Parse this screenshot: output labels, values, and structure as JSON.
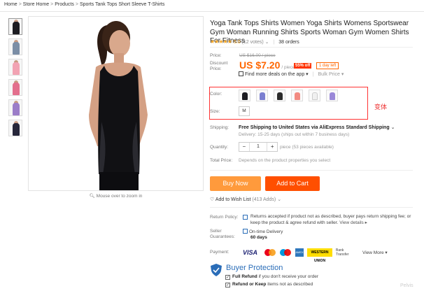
{
  "breadcrumb": [
    "Home",
    "Store Home",
    "Products",
    "Sports Tank Tops Short Sleeve T-Shirts"
  ],
  "gallery": {
    "thumb_colors": [
      "#1c1c22",
      "#7b8ea6",
      "#f2a3b3",
      "#e36f8d",
      "#9b7dc8",
      "#26263a"
    ],
    "zoom_hint": "Mouse over to zoom in"
  },
  "product": {
    "title": "Yoga Tank Tops Shirts Women Yoga Shirts Womens Sportswear Gym Woman Running Shirts Sports Woman Gym Women Shirts For Fitness",
    "rating": "5.0",
    "votes": "(12 votes)",
    "orders": "38 orders",
    "price_label": "Price:",
    "old_price": "US $16.00 / piece",
    "discount_label_1": "Discount",
    "discount_label_2": "Price:",
    "new_price": "US $7.20",
    "unit": "/ piece",
    "discount_badge": "55% off",
    "days_left": "1 day left",
    "app_deals": "Find more deals on the app",
    "bulk_price": "Bulk Price"
  },
  "variants": {
    "color_label": "Color:",
    "color_swatches": [
      "#1c1c22",
      "#7b7fd0",
      "#2b2b2b",
      "#f28b82",
      "#f0f0f0",
      "#9a88d8"
    ],
    "size_label": "Size:",
    "size_value": "M",
    "annotation": "变体"
  },
  "shipping": {
    "label": "Shipping:",
    "text": "Free Shipping to United States via AliExpress Standard Shipping",
    "delivery": "Delivery: 15-25 days (ships out within 7 business days)"
  },
  "quantity": {
    "label": "Quantity:",
    "minus": "−",
    "value": "1",
    "plus": "+",
    "note": "piece (53 pieces available)"
  },
  "total": {
    "label": "Total Price:",
    "text": "Depends on the product properties you select"
  },
  "buttons": {
    "buy_now": "Buy Now",
    "add_to_cart": "Add to Cart"
  },
  "wishlist": {
    "text": "Add to Wish List",
    "count": "(413 Adds)"
  },
  "return_policy": {
    "label": "Return Policy:",
    "text": "Returns accepted if product not as described, buyer pays return shipping fee; or keep the product & agree refund with seller.",
    "link": "View details"
  },
  "guarantee": {
    "label_1": "Seller",
    "label_2": "Guarantees:",
    "title": "On-time Delivery",
    "days": "60 days"
  },
  "payment": {
    "label": "Payment:",
    "visa": "VISA",
    "amex": "AMEX",
    "wu": "WESTERN UNION",
    "bank_1": "Bank",
    "bank_2": "Transfer",
    "view_more": "View More"
  },
  "buyer_protection": {
    "title": "Buyer Protection",
    "item1_bold": "Full Refund",
    "item1_rest": "if you don't receive your order",
    "item2_bold": "Refund or Keep",
    "item2_rest": "items not as described"
  },
  "watermark": "Pelvis"
}
